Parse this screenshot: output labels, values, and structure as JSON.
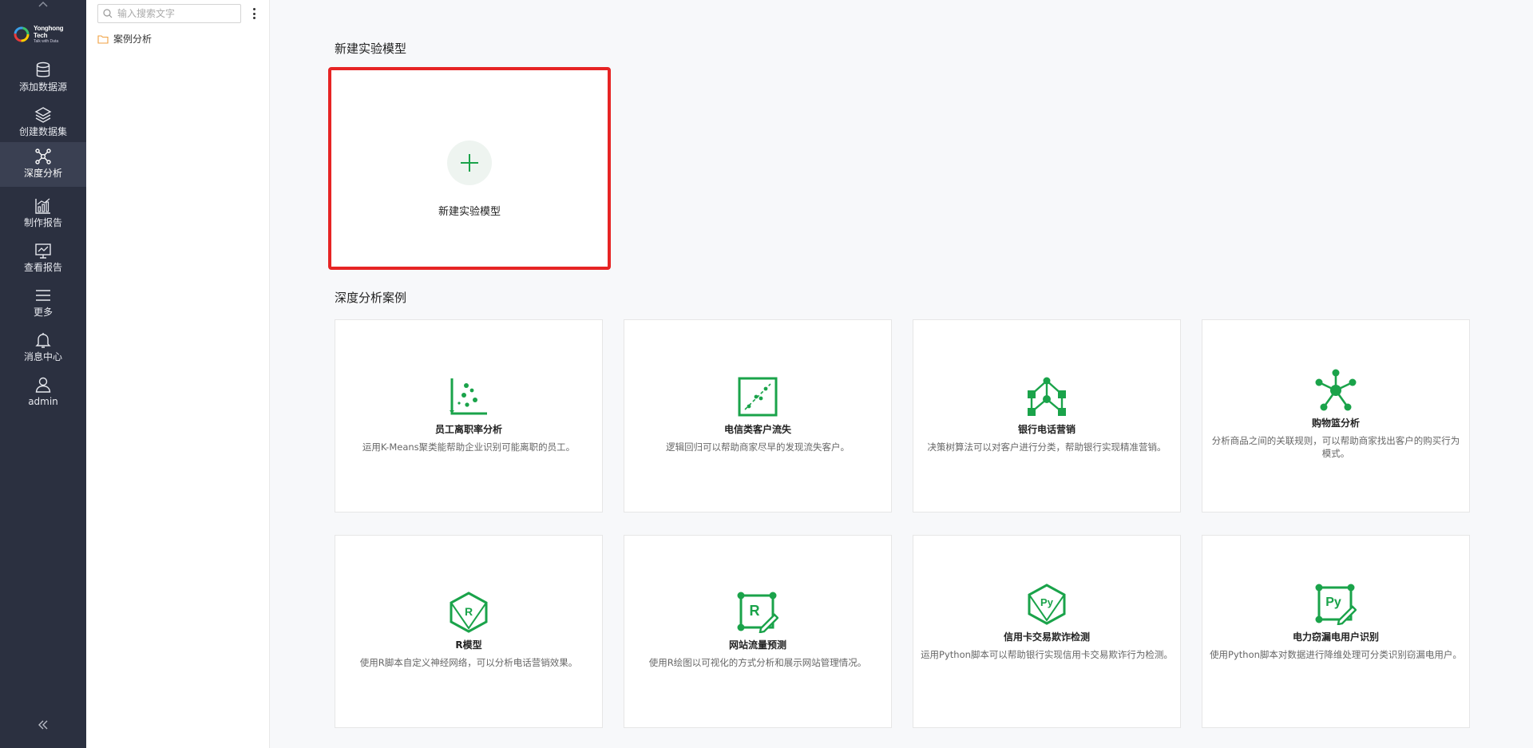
{
  "brand": {
    "name": "Yonghong Tech",
    "tagline": "Talk with Data"
  },
  "nav": {
    "items": [
      {
        "label": "添加数据源",
        "icon": "database-icon"
      },
      {
        "label": "创建数据集",
        "icon": "layers-icon"
      },
      {
        "label": "深度分析",
        "icon": "network-icon",
        "active": true
      },
      {
        "label": "制作报告",
        "icon": "bar-chart-icon"
      },
      {
        "label": "查看报告",
        "icon": "monitor-chart-icon"
      },
      {
        "label": "更多",
        "icon": "menu-icon"
      },
      {
        "label": "消息中心",
        "icon": "bell-icon"
      },
      {
        "label": "admin",
        "icon": "user-icon"
      }
    ]
  },
  "tree": {
    "search_placeholder": "输入搜索文字",
    "folder_label": "案例分析"
  },
  "main": {
    "new_section_title": "新建实验模型",
    "new_card_label": "新建实验模型",
    "cases_section_title": "深度分析案例",
    "cases": [
      {
        "title": "员工离职率分析",
        "desc": "运用K-Means聚类能帮助企业识别可能离职的员工。",
        "icon": "scatter-plot-icon"
      },
      {
        "title": "电信类客户流失",
        "desc": "逻辑回归可以帮助商家尽早的发现流失客户。",
        "icon": "regression-icon"
      },
      {
        "title": "银行电话营销",
        "desc": "决策树算法可以对客户进行分类，帮助银行实现精准营销。",
        "icon": "decision-tree-icon"
      },
      {
        "title": "购物篮分析",
        "desc": "分析商品之间的关联规则，可以帮助商家找出客户的购买行为模式。",
        "icon": "association-icon"
      },
      {
        "title": "R模型",
        "desc": "使用R脚本自定义神经网络，可以分析电话营销效果。",
        "icon": "r-model-icon"
      },
      {
        "title": "网站流量预测",
        "desc": "使用R绘图以可视化的方式分析和展示网站管理情况。",
        "icon": "r-chart-icon"
      },
      {
        "title": "信用卡交易欺诈检测",
        "desc": "运用Python脚本可以帮助银行实现信用卡交易欺诈行为检测。",
        "icon": "python-model-icon"
      },
      {
        "title": "电力窃漏电用户识别",
        "desc": "使用Python脚本对数据进行降维处理可分类识别窃漏电用户。",
        "icon": "python-chart-icon"
      }
    ]
  },
  "colors": {
    "accent": "#1aa34a",
    "nav_bg": "#2b3040",
    "highlight": "#e62424"
  }
}
